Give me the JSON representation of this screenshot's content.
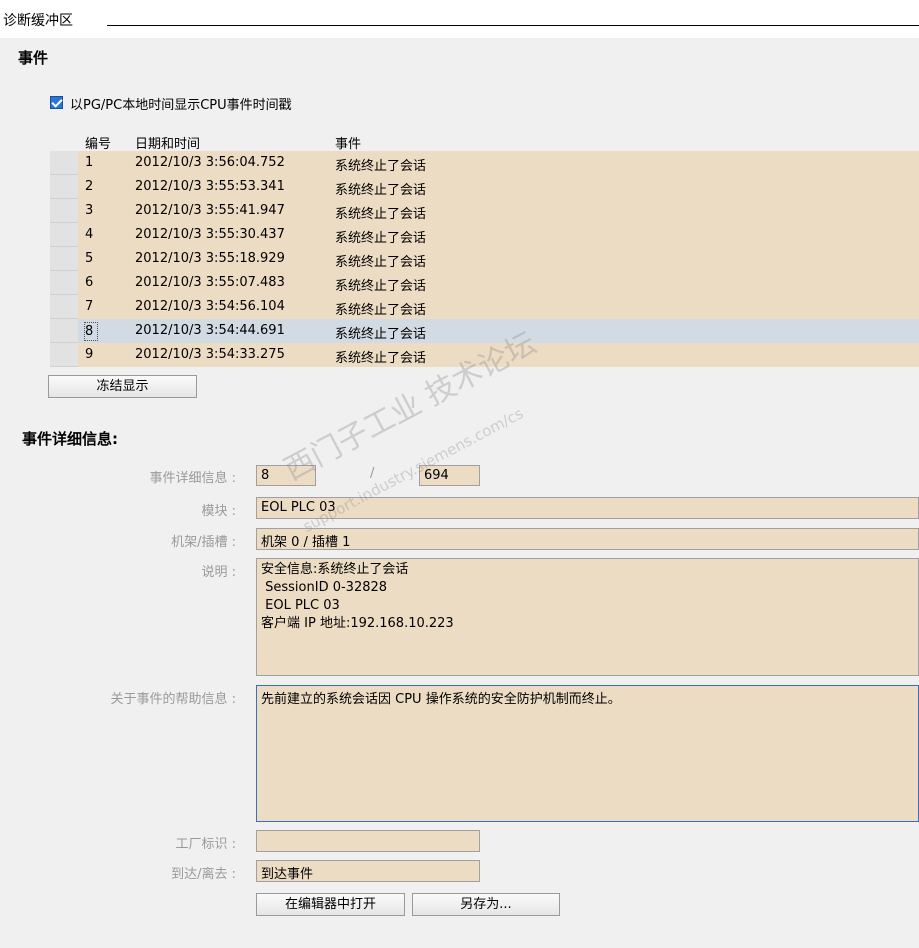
{
  "panel": {
    "title": "诊断缓冲区"
  },
  "events": {
    "heading": "事件",
    "checkbox_label": "以PG/PC本地时间显示CPU事件时间戳",
    "columns": [
      "编号",
      "日期和时间",
      "事件"
    ],
    "rows": [
      {
        "no": "1",
        "datetime": "2012/10/3 3:56:04.752",
        "event": "系统终止了会话"
      },
      {
        "no": "2",
        "datetime": "2012/10/3 3:55:53.341",
        "event": "系统终止了会话"
      },
      {
        "no": "3",
        "datetime": "2012/10/3 3:55:41.947",
        "event": "系统终止了会话"
      },
      {
        "no": "4",
        "datetime": "2012/10/3 3:55:30.437",
        "event": "系统终止了会话"
      },
      {
        "no": "5",
        "datetime": "2012/10/3 3:55:18.929",
        "event": "系统终止了会话"
      },
      {
        "no": "6",
        "datetime": "2012/10/3 3:55:07.483",
        "event": "系统终止了会话"
      },
      {
        "no": "7",
        "datetime": "2012/10/3 3:54:56.104",
        "event": "系统终止了会话"
      },
      {
        "no": "8",
        "datetime": "2012/10/3 3:54:44.691",
        "event": "系统终止了会话"
      },
      {
        "no": "9",
        "datetime": "2012/10/3 3:54:33.275",
        "event": "系统终止了会话"
      }
    ],
    "freeze_button": "冻结显示"
  },
  "details": {
    "heading": "事件详细信息:",
    "labels": {
      "event_detail": "事件详细信息 :",
      "module": "模块 :",
      "rack_slot": "机架/插槽 :",
      "description": "说明 :",
      "help": "关于事件的帮助信息 :",
      "plant_tag": "工厂标识 :",
      "coming_going": "到达/离去 :"
    },
    "event_index": "8",
    "separator": "/",
    "event_total": "694",
    "module": "EOL PLC 03",
    "rack_slot": "机架 0 / 插槽 1",
    "description_lines": [
      "安全信息:系统终止了会话",
      " SessionID 0-32828",
      "",
      " EOL PLC 03",
      "",
      "",
      "客户端 IP 地址:192.168.10.223"
    ],
    "help": "先前建立的系统会话因 CPU 操作系统的安全防护机制而终止。",
    "plant_tag": "",
    "coming_going": "到达事件",
    "open_in_editor_button": "在编辑器中打开",
    "save_as_button": "另存为..."
  },
  "watermark": {
    "line1": "西门子工业 技术论坛",
    "line2": "support.industry.siemens.com/cs"
  },
  "colors": {
    "field_bg": "#ecdcc4",
    "selected_row": "#d2dbe4",
    "checkbox": "#2b74d8",
    "focus_border": "#3b6fb6"
  }
}
